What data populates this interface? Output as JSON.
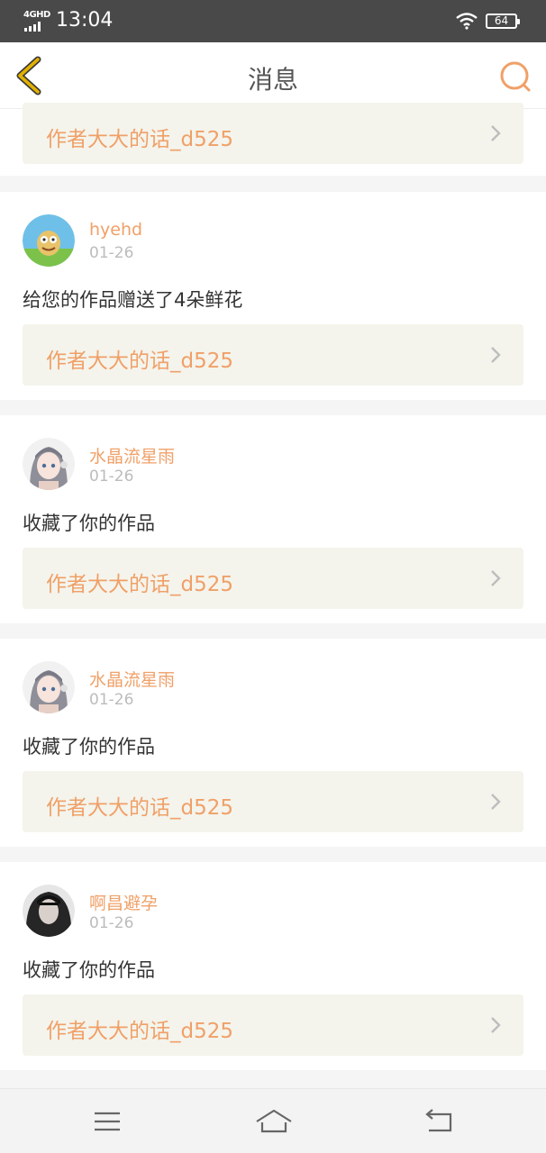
{
  "status_bar": {
    "network": "4GHD",
    "time": "13:04",
    "battery": "64"
  },
  "header": {
    "title": "消息",
    "back_icon": "chevron-left-icon",
    "search_icon": "search-icon"
  },
  "colors": {
    "accent": "#f0a068",
    "back_icon": "#e2b100",
    "link_bg": "#f4f4ec"
  },
  "partial_item": {
    "work_title": "作者大大的话_d525"
  },
  "messages": [
    {
      "username": "hyehd",
      "date": "01-26",
      "action": "给您的作品赠送了4朵鲜花",
      "work_title": "作者大大的话_d525",
      "avatar": "cartoon-avatar"
    },
    {
      "username": "水晶流星雨",
      "date": "01-26",
      "action": "收藏了你的作品",
      "work_title": "作者大大的话_d525",
      "avatar": "anime-girl-avatar"
    },
    {
      "username": "水晶流星雨",
      "date": "01-26",
      "action": "收藏了你的作品",
      "work_title": "作者大大的话_d525",
      "avatar": "anime-girl-avatar"
    },
    {
      "username": "啊昌避孕",
      "date": "01-26",
      "action": "收藏了你的作品",
      "work_title": "作者大大的话_d525",
      "avatar": "photo-avatar"
    }
  ],
  "nav_bar": {
    "menu_icon": "menu-icon",
    "home_icon": "home-icon",
    "back_icon": "back-arrow-icon"
  }
}
